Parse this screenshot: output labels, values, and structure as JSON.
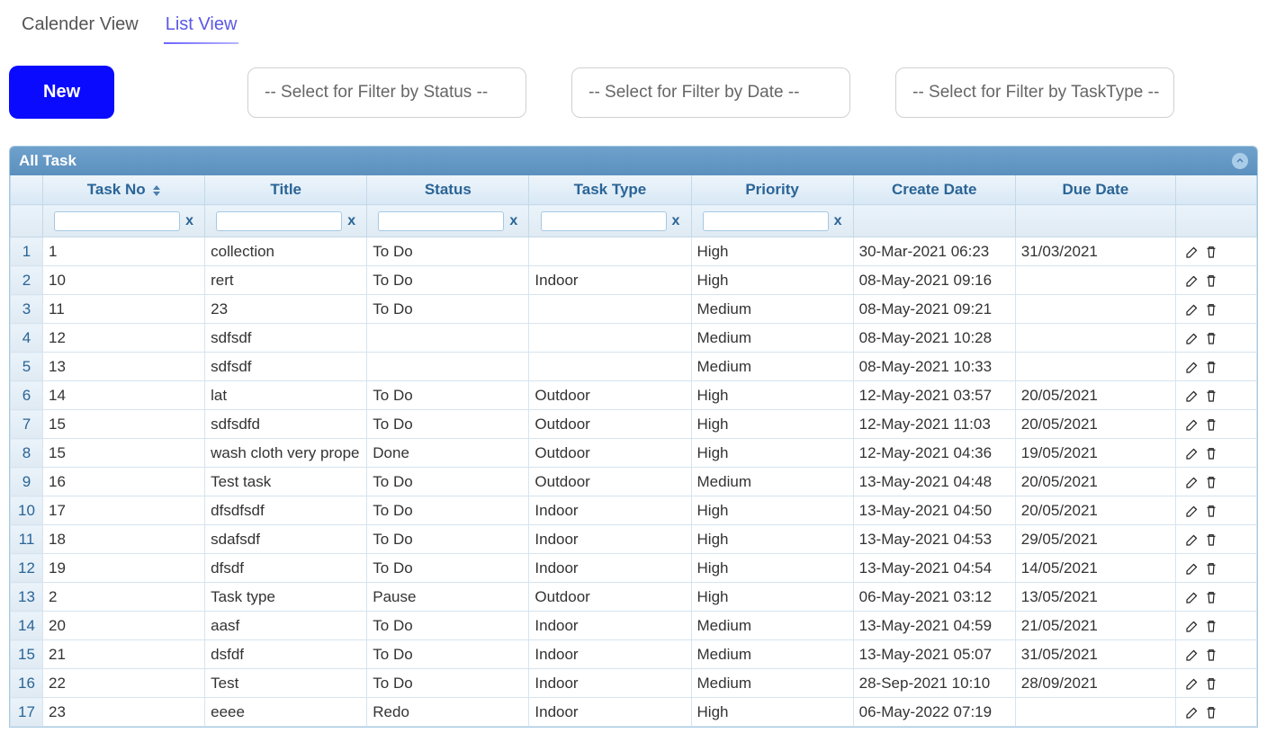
{
  "tabs": {
    "calendar": "Calender View",
    "list": "List View"
  },
  "buttons": {
    "new": "New"
  },
  "filters": {
    "status": "-- Select for Filter by Status --",
    "date": "-- Select for Filter by Date --",
    "tasktype": "-- Select for Filter by TaskType --"
  },
  "panel": {
    "title": "All Task"
  },
  "columns": {
    "taskno": "Task No",
    "title": "Title",
    "status": "Status",
    "tasktype": "Task Type",
    "priority": "Priority",
    "create": "Create Date",
    "due": "Due Date"
  },
  "filterClear": "x",
  "rows": [
    {
      "n": "1",
      "taskno": "1",
      "title": "collection",
      "status": "To Do",
      "ttype": "",
      "prio": "High",
      "create": "30-Mar-2021 06:23",
      "due": "31/03/2021"
    },
    {
      "n": "2",
      "taskno": "10",
      "title": "rert",
      "status": "To Do",
      "ttype": "Indoor",
      "prio": "High",
      "create": "08-May-2021 09:16",
      "due": ""
    },
    {
      "n": "3",
      "taskno": "11",
      "title": "23",
      "status": "To Do",
      "ttype": "",
      "prio": "Medium",
      "create": "08-May-2021 09:21",
      "due": ""
    },
    {
      "n": "4",
      "taskno": "12",
      "title": "sdfsdf",
      "status": "",
      "ttype": "",
      "prio": "Medium",
      "create": "08-May-2021 10:28",
      "due": ""
    },
    {
      "n": "5",
      "taskno": "13",
      "title": "sdfsdf",
      "status": "",
      "ttype": "",
      "prio": "Medium",
      "create": "08-May-2021 10:33",
      "due": ""
    },
    {
      "n": "6",
      "taskno": "14",
      "title": "lat",
      "status": "To Do",
      "ttype": "Outdoor",
      "prio": "High",
      "create": "12-May-2021 03:57",
      "due": "20/05/2021"
    },
    {
      "n": "7",
      "taskno": "15",
      "title": "sdfsdfd",
      "status": "To Do",
      "ttype": "Outdoor",
      "prio": "High",
      "create": "12-May-2021 11:03",
      "due": "20/05/2021"
    },
    {
      "n": "8",
      "taskno": "15",
      "title": "wash cloth very prope",
      "status": "Done",
      "ttype": "Outdoor",
      "prio": "High",
      "create": "12-May-2021 04:36",
      "due": "19/05/2021"
    },
    {
      "n": "9",
      "taskno": "16",
      "title": "Test task",
      "status": "To Do",
      "ttype": "Outdoor",
      "prio": "Medium",
      "create": "13-May-2021 04:48",
      "due": "20/05/2021"
    },
    {
      "n": "10",
      "taskno": "17",
      "title": "dfsdfsdf",
      "status": "To Do",
      "ttype": "Indoor",
      "prio": "High",
      "create": "13-May-2021 04:50",
      "due": "20/05/2021"
    },
    {
      "n": "11",
      "taskno": "18",
      "title": "sdafsdf",
      "status": "To Do",
      "ttype": "Indoor",
      "prio": "High",
      "create": "13-May-2021 04:53",
      "due": "29/05/2021"
    },
    {
      "n": "12",
      "taskno": "19",
      "title": "dfsdf",
      "status": "To Do",
      "ttype": "Indoor",
      "prio": "High",
      "create": "13-May-2021 04:54",
      "due": "14/05/2021"
    },
    {
      "n": "13",
      "taskno": "2",
      "title": "Task type",
      "status": "Pause",
      "ttype": "Outdoor",
      "prio": "High",
      "create": "06-May-2021 03:12",
      "due": "13/05/2021"
    },
    {
      "n": "14",
      "taskno": "20",
      "title": "aasf",
      "status": "To Do",
      "ttype": "Indoor",
      "prio": "Medium",
      "create": "13-May-2021 04:59",
      "due": "21/05/2021"
    },
    {
      "n": "15",
      "taskno": "21",
      "title": "dsfdf",
      "status": "To Do",
      "ttype": "Indoor",
      "prio": "Medium",
      "create": "13-May-2021 05:07",
      "due": "31/05/2021"
    },
    {
      "n": "16",
      "taskno": "22",
      "title": "Test",
      "status": "To Do",
      "ttype": "Indoor",
      "prio": "Medium",
      "create": "28-Sep-2021 10:10",
      "due": "28/09/2021"
    },
    {
      "n": "17",
      "taskno": "23",
      "title": "eeee",
      "status": "Redo",
      "ttype": "Indoor",
      "prio": "High",
      "create": "06-May-2022 07:19",
      "due": ""
    }
  ]
}
